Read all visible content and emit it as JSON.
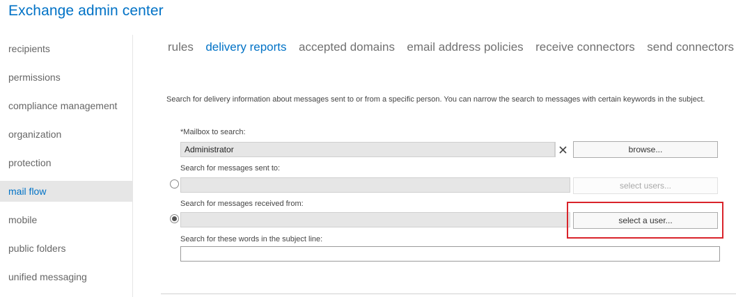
{
  "app": {
    "title": "Exchange admin center"
  },
  "sidebar": {
    "items": [
      {
        "label": "recipients"
      },
      {
        "label": "permissions"
      },
      {
        "label": "compliance management"
      },
      {
        "label": "organization"
      },
      {
        "label": "protection"
      },
      {
        "label": "mail flow",
        "active": true
      },
      {
        "label": "mobile"
      },
      {
        "label": "public folders"
      },
      {
        "label": "unified messaging"
      }
    ]
  },
  "tabs": [
    {
      "label": "rules"
    },
    {
      "label": "delivery reports",
      "active": true
    },
    {
      "label": "accepted domains"
    },
    {
      "label": "email address policies"
    },
    {
      "label": "receive connectors"
    },
    {
      "label": "send connectors"
    }
  ],
  "form": {
    "description": "Search for delivery information about messages sent to or from a specific person. You can narrow the search to messages with certain keywords in the subject.",
    "mailbox": {
      "label": "*Mailbox to search:",
      "value": "Administrator",
      "browse_label": "browse..."
    },
    "sent_to": {
      "label": "Search for messages sent to:",
      "value": "",
      "button_label": "select users...",
      "selected": false,
      "enabled": false
    },
    "received_from": {
      "label": "Search for messages received from:",
      "value": "",
      "button_label": "select a user...",
      "selected": true,
      "enabled": true
    },
    "subject": {
      "label": "Search for these words in the subject line:",
      "value": ""
    }
  },
  "colors": {
    "accent": "#0072c6",
    "highlight_box": "#d9232a",
    "sidebar_active_bg": "#e6e6e6"
  }
}
